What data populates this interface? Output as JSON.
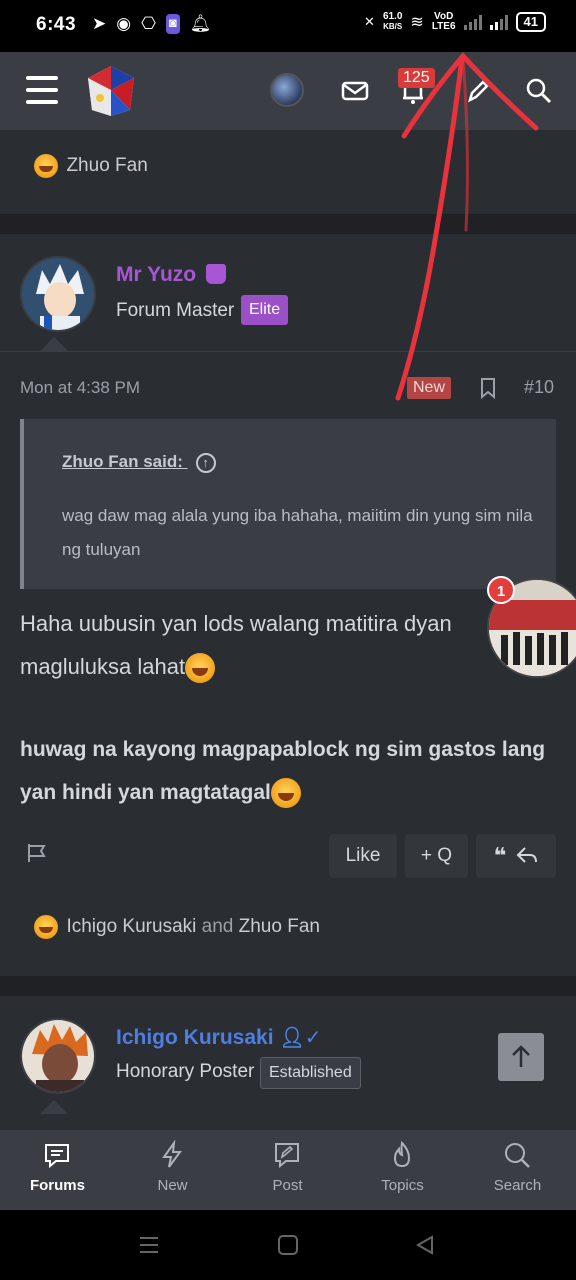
{
  "status_bar": {
    "time": "6:43",
    "speed_value": "61.0",
    "speed_unit": "KB/S",
    "network_tag_top": "VoD",
    "network_tag_bottom": "LTE6",
    "battery": "41"
  },
  "header": {
    "notification_count": "125",
    "icons": [
      "menu-icon",
      "site-logo",
      "user-avatar",
      "mail-icon",
      "bell-icon",
      "edit-icon",
      "search-icon"
    ]
  },
  "top_reactions": {
    "names": "Zhuo Fan"
  },
  "post": {
    "username": "Mr Yuzo",
    "user_title": "Forum Master",
    "user_badge": "Elite",
    "date": "Mon at 4:38 PM",
    "new_label": "New",
    "post_number": "#10",
    "quote_author": "Zhuo Fan said:",
    "quote_text": "wag daw mag alala yung iba hahaha, maiitim din yung sim nila ng tuluyan",
    "body_line1": "Haha uubusin yan lods walang matitira dyan magluluksa lahat",
    "body_bold": "huwag na kayong magpapablock ng sim gastos lang yan hindi yan magtatagal",
    "like_label": "Like",
    "quote_btn_label": "+ Q",
    "reactions_name1": "Ichigo Kurusaki",
    "reactions_and": "and",
    "reactions_name2": "Zhuo Fan"
  },
  "next_post": {
    "username": "Ichigo Kurusaki",
    "user_title": "Honorary Poster",
    "user_badge": "Established"
  },
  "chat_head": {
    "count": "1"
  },
  "bottom_nav": {
    "items": [
      {
        "label": "Forums",
        "icon": "forums-icon"
      },
      {
        "label": "New",
        "icon": "lightning-icon"
      },
      {
        "label": "Post",
        "icon": "post-icon"
      },
      {
        "label": "Topics",
        "icon": "flame-icon"
      },
      {
        "label": "Search",
        "icon": "search-icon"
      }
    ]
  },
  "colors": {
    "username_purple": "#a855d6",
    "username_blue": "#4c7fe0",
    "elite_badge": "#9b4fc9",
    "annotation_red": "#e8323c"
  }
}
